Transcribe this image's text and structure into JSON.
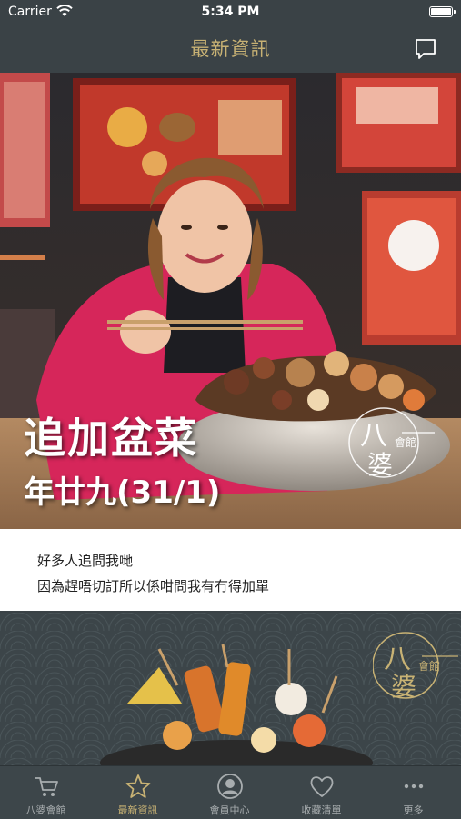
{
  "status_bar": {
    "carrier": "Carrier",
    "time": "5:34 PM"
  },
  "navbar": {
    "title": "最新資訊"
  },
  "posts": [
    {
      "overlay_title": "追加盆菜",
      "overlay_subtitle": "年廿九(31/1)",
      "logo_line1": "八",
      "logo_line2": "婆",
      "logo_tag": "會館",
      "caption": [
        "好多人追問我哋",
        "因為趕唔切訂所以係咁問我有冇得加單"
      ]
    },
    {
      "logo_line1": "八",
      "logo_line2": "婆",
      "logo_tag": "會館"
    }
  ],
  "tabbar": {
    "items": [
      {
        "label": "八婆會館",
        "icon": "cart-icon",
        "active": false
      },
      {
        "label": "最新資訊",
        "icon": "star-icon",
        "active": true
      },
      {
        "label": "會員中心",
        "icon": "member-icon",
        "active": false
      },
      {
        "label": "收藏清單",
        "icon": "heart-icon",
        "active": false
      },
      {
        "label": "更多",
        "icon": "more-icon",
        "active": false
      }
    ]
  },
  "colors": {
    "bar_bg": "#3a4246",
    "accent_gold": "#c8b274",
    "tab_inactive": "#a8adaf"
  }
}
